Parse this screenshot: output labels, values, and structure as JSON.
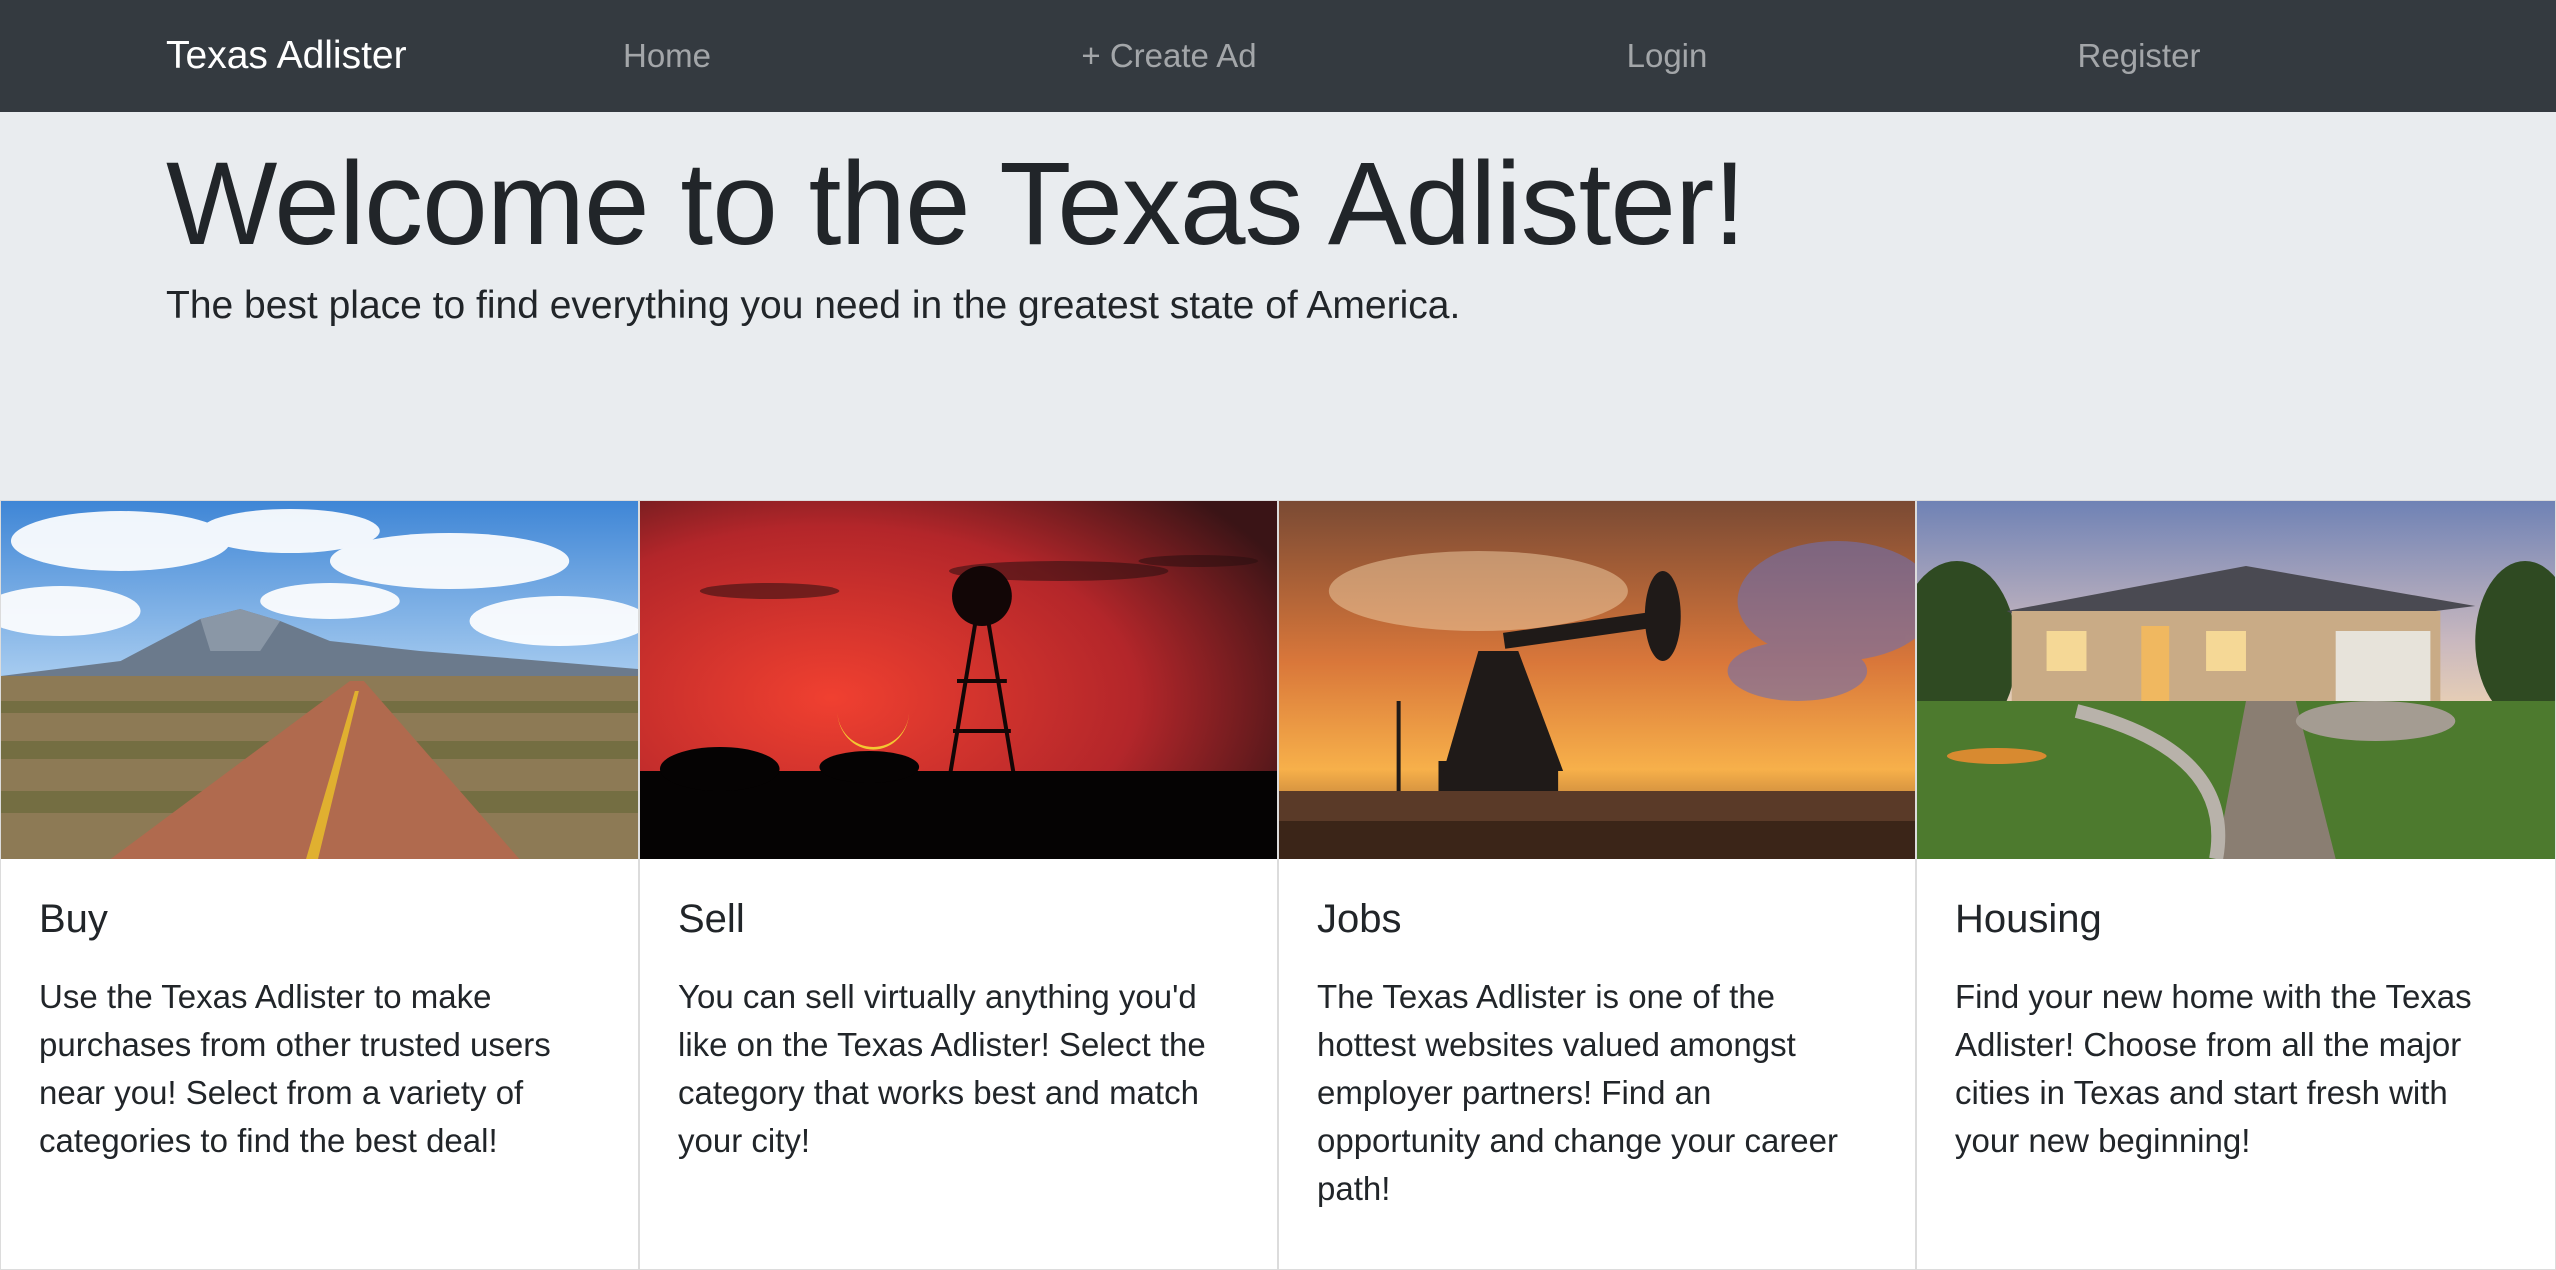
{
  "navbar": {
    "brand": "Texas Adlister",
    "links": [
      {
        "label": "Home"
      },
      {
        "label": "+ Create Ad"
      },
      {
        "label": "Login"
      },
      {
        "label": "Register"
      }
    ]
  },
  "jumbotron": {
    "title": "Welcome to the Texas Adlister!",
    "lead": "The best place to find everything you need in the greatest state of America."
  },
  "cards": [
    {
      "title": "Buy",
      "text": "Use the Texas Adlister to make purchases from other trusted users near you! Select from a variety of categories to find the best deal!"
    },
    {
      "title": "Sell",
      "text": "You can sell virtually anything you'd like on the Texas Adlister! Select the category that works best and match your city!"
    },
    {
      "title": "Jobs",
      "text": "The Texas Adlister is one of the hottest websites valued amongst employer partners! Find an opportunity and change your career path!"
    },
    {
      "title": "Housing",
      "text": "Find your new home with the Texas Adlister! Choose from all the major cities in Texas and start fresh with your new beginning!"
    }
  ],
  "colors": {
    "navbar_bg": "#343a40",
    "jumbotron_bg": "#e9ecef",
    "text": "#212529"
  }
}
